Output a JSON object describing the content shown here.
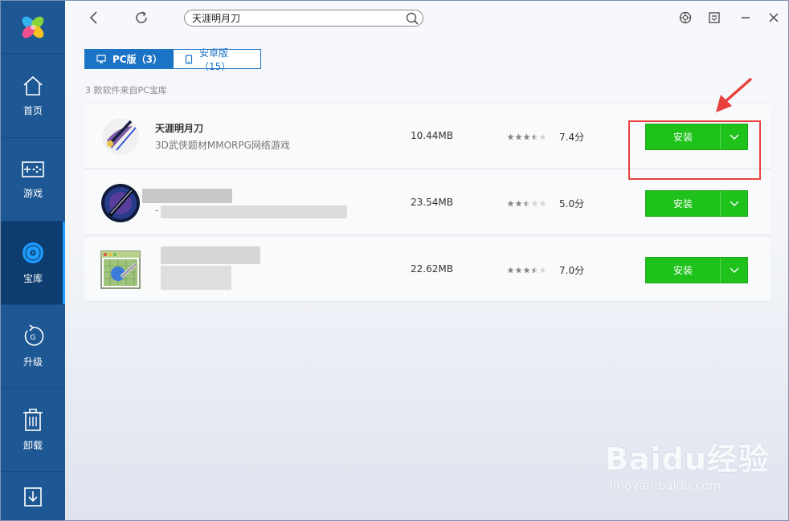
{
  "nav": {
    "items": [
      {
        "label": "首页",
        "icon": "home-icon"
      },
      {
        "label": "游戏",
        "icon": "gamepad-icon"
      },
      {
        "label": "宝库",
        "icon": "disc-icon"
      },
      {
        "label": "升级",
        "icon": "upgrade-icon"
      },
      {
        "label": "卸载",
        "icon": "trash-icon"
      },
      {
        "label": "",
        "icon": "download-icon"
      }
    ],
    "active_index": 2
  },
  "search": {
    "value": "天涯明月刀"
  },
  "tabs": {
    "pc": {
      "label": "PC版（3）"
    },
    "android": {
      "label": "安卓版（15）"
    }
  },
  "result_summary": "3 款软件来自PC宝库",
  "apps": [
    {
      "name": "天涯明月刀",
      "desc": "3D武侠题材MMORPG网络游戏",
      "size": "10.44MB",
      "rating": 3.5,
      "score": "7.4分",
      "install_label": "安装"
    },
    {
      "name": "",
      "desc": "-",
      "size": "23.54MB",
      "rating": 2.5,
      "score": "5.0分",
      "install_label": "安装"
    },
    {
      "name": "",
      "desc": "",
      "size": "22.62MB",
      "rating": 3.5,
      "score": "7.0分",
      "install_label": "安装"
    }
  ],
  "watermark": {
    "brand": "Baidu经验",
    "url": "jingyan.baidu.com"
  },
  "colors": {
    "sidebar": "#1e5894",
    "sidebar_active": "#0d3d6e",
    "tab_blue": "#1b73c6",
    "install_green": "#1ec21a",
    "annotation_red": "#e8413d"
  }
}
